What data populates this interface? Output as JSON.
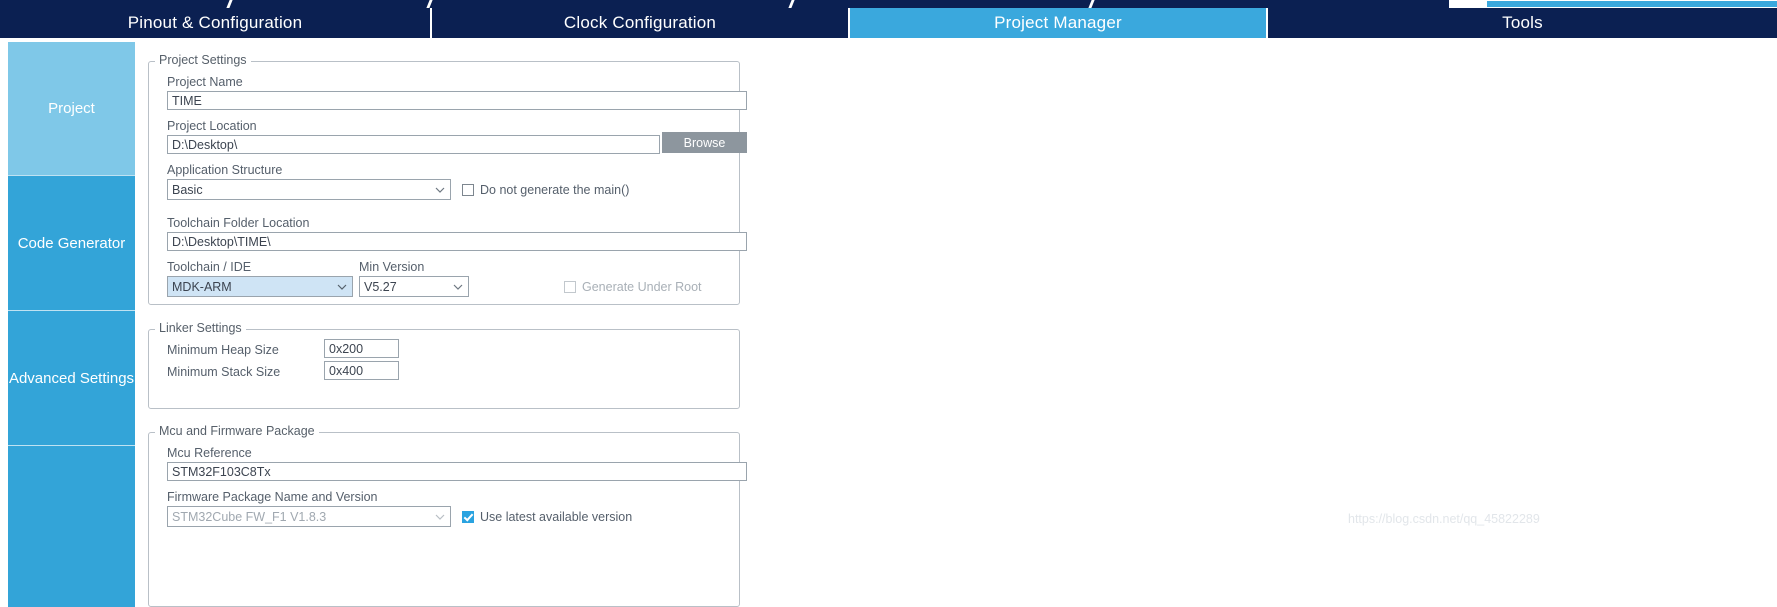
{
  "window": {
    "tabs": [
      {
        "label": "Pinout & Configuration",
        "active": false
      },
      {
        "label": "Clock Configuration",
        "active": false
      },
      {
        "label": "Project Manager",
        "active": true
      },
      {
        "label": "Tools",
        "active": false
      }
    ]
  },
  "sidebar": {
    "items": [
      {
        "label": "Project",
        "selected": true
      },
      {
        "label": "Code Generator",
        "selected": false
      },
      {
        "label": "Advanced Settings",
        "selected": false
      },
      {
        "label": "",
        "selected": false
      }
    ]
  },
  "project_settings": {
    "group_title": "Project Settings",
    "project_name_label": "Project Name",
    "project_name_value": "TIME",
    "project_location_label": "Project Location",
    "project_location_value": "D:\\Desktop\\",
    "browse_button": "Browse",
    "application_structure_label": "Application Structure",
    "application_structure_value": "Basic",
    "do_not_generate_main_label": "Do not generate the main()",
    "do_not_generate_main_checked": false,
    "toolchain_folder_label": "Toolchain Folder Location",
    "toolchain_folder_value": "D:\\Desktop\\TIME\\",
    "toolchain_ide_label": "Toolchain / IDE",
    "toolchain_ide_value": "MDK-ARM",
    "min_version_label": "Min Version",
    "min_version_value": "V5.27",
    "generate_under_root_label": "Generate Under Root",
    "generate_under_root_checked": false,
    "generate_under_root_disabled": true
  },
  "linker_settings": {
    "group_title": "Linker Settings",
    "min_heap_label": "Minimum Heap Size",
    "min_heap_value": "0x200",
    "min_stack_label": "Minimum Stack Size",
    "min_stack_value": "0x400"
  },
  "mcu_firmware": {
    "group_title": "Mcu and Firmware Package",
    "mcu_reference_label": "Mcu Reference",
    "mcu_reference_value": "STM32F103C8Tx",
    "firmware_package_label": "Firmware Package Name and Version",
    "firmware_package_value": "STM32Cube FW_F1 V1.8.3",
    "use_latest_label": "Use latest available version",
    "use_latest_checked": true
  },
  "watermark": {
    "text": "https://blog.csdn.net/qq_45822289"
  },
  "colors": {
    "tab_inactive": "#0b2052",
    "tab_active": "#3aa8dd",
    "sidebar": "#33a4d8",
    "sidebar_selected": "#7fc8e8",
    "browse_button": "#8d969e",
    "checkbox_checked": "#2aa3e0",
    "combo_highlight": "#cfe4f5"
  }
}
